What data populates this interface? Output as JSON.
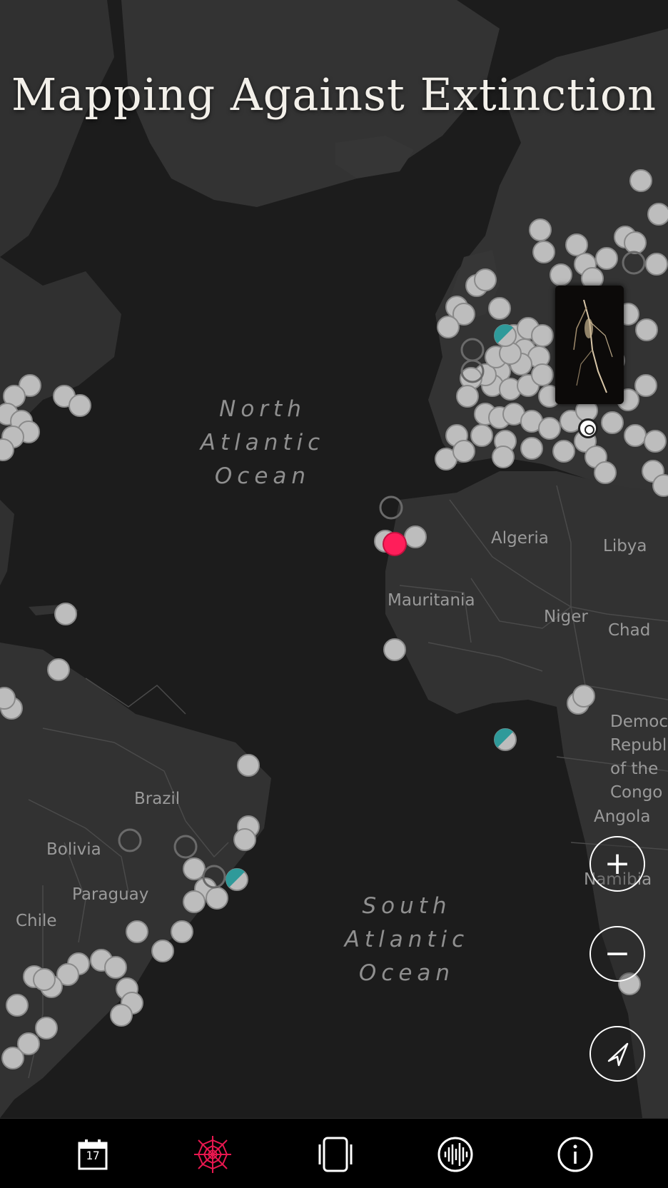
{
  "title": "Mapping Against Extinction",
  "map": {
    "oceans": [
      {
        "id": "north-atlantic",
        "text": "North Atlantic Ocean"
      },
      {
        "id": "south-atlantic",
        "text": "South Atlantic Ocean"
      }
    ],
    "countries": [
      "Algeria",
      "Libya",
      "Mauritania",
      "Niger",
      "Chad",
      "Brazil",
      "Bolivia",
      "Paraguay",
      "Chile",
      "Angola",
      "Namibia",
      "Democratic Republic of the Congo"
    ],
    "colors": {
      "ocean": "#1c1c1c",
      "land": "#333333",
      "marker": "#bdbdbd",
      "marker_selected": "#ff1e5a",
      "marker_teal": "#2f9a9a"
    }
  },
  "controls": {
    "zoom_in": "+",
    "zoom_out": "−",
    "locate_icon": "navigation-arrow-icon"
  },
  "tabs": [
    {
      "name": "calendar",
      "icon": "calendar-icon",
      "badge": "17",
      "active": false
    },
    {
      "name": "web",
      "icon": "spider-web-icon",
      "active": true
    },
    {
      "name": "device",
      "icon": "phone-frame-icon",
      "active": false
    },
    {
      "name": "sound",
      "icon": "sound-wave-icon",
      "active": false
    },
    {
      "name": "info",
      "icon": "info-icon",
      "active": false
    }
  ],
  "active_color": "#e8174f"
}
